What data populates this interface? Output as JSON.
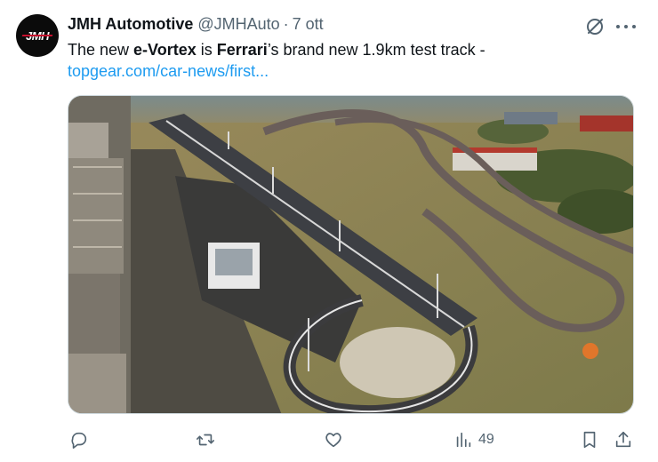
{
  "author": {
    "avatar_text": "JMH",
    "name": "JMH Automotive",
    "handle": "@JMHAuto",
    "separator": "·",
    "date": "7 ott"
  },
  "tweet": {
    "text_parts": [
      "The new ",
      "e-Vortex",
      " is ",
      "Ferrari",
      "’s brand new 1.9km test track -"
    ],
    "link": "topgear.com/car-news/first..."
  },
  "media": {
    "description_icon": "aerial-track-photo"
  },
  "actions": {
    "reply_count": "",
    "retweet_count": "",
    "like_count": "",
    "views_count": "49"
  },
  "colors": {
    "text": "#0f1419",
    "secondary": "#536471",
    "link": "#1d9bf0",
    "border": "#cfd9de"
  }
}
